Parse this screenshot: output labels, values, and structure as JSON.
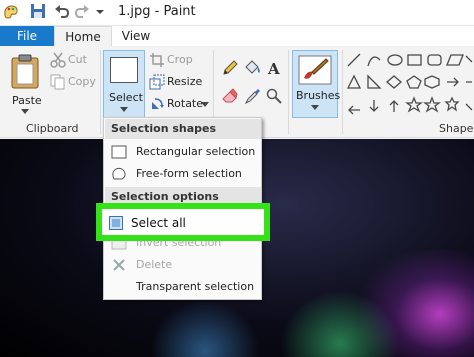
{
  "window": {
    "title": "1.jpg - Paint"
  },
  "tabs": {
    "file": "File",
    "home": "Home",
    "view": "View"
  },
  "ribbon": {
    "clipboard": {
      "paste_label": "Paste",
      "cut_label": "Cut",
      "copy_label": "Copy",
      "group_label": "Clipboard"
    },
    "image": {
      "select_label": "Select",
      "crop_label": "Crop",
      "resize_label": "Resize",
      "rotate_label": "Rotate"
    },
    "brushes_label": "Brushes",
    "shapes_group_label": "Shapes"
  },
  "select_menu": {
    "shapes_header": "Selection shapes",
    "rectangular": "Rectangular selection",
    "freeform": "Free-form selection",
    "options_header": "Selection options",
    "select_all": "Select all",
    "invert": "Invert selection",
    "delete": "Delete",
    "transparent": "Transparent selection"
  },
  "colors": {
    "file_tab": "#1979ca",
    "highlight": "#35e21a",
    "selected_button": "#cde4f7"
  }
}
